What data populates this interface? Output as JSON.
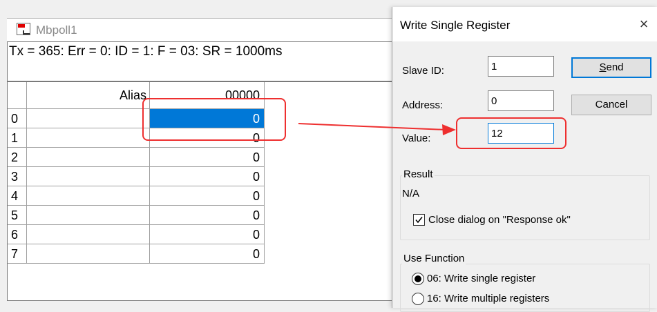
{
  "main_window": {
    "title": "Mbpoll1",
    "status_line": "Tx = 365: Err = 0: ID = 1: F = 03: SR = 1000ms",
    "grid": {
      "headers": {
        "row_number": "",
        "alias": "Alias",
        "register": "00000"
      },
      "rows": [
        {
          "index": "0",
          "alias": "",
          "value": "0",
          "selected": true
        },
        {
          "index": "1",
          "alias": "",
          "value": "0"
        },
        {
          "index": "2",
          "alias": "",
          "value": "0"
        },
        {
          "index": "3",
          "alias": "",
          "value": "0"
        },
        {
          "index": "4",
          "alias": "",
          "value": "0"
        },
        {
          "index": "5",
          "alias": "",
          "value": "0"
        },
        {
          "index": "6",
          "alias": "",
          "value": "0"
        },
        {
          "index": "7",
          "alias": "",
          "value": "0"
        }
      ]
    }
  },
  "dialog": {
    "title": "Write Single Register",
    "close_glyph": "×",
    "slave_id": {
      "label": "Slave ID:",
      "value": "1"
    },
    "address": {
      "label": "Address:",
      "value": "0"
    },
    "value": {
      "label": "Value:",
      "value": "12"
    },
    "send_button": {
      "label_accel": "S",
      "label_rest": "end"
    },
    "cancel_button": {
      "label": "Cancel"
    },
    "result": {
      "title": "Result",
      "text": "N/A",
      "close_on_ok_label": "Close dialog on \"Response ok\"",
      "close_on_ok_checked": true
    },
    "use_function": {
      "title": "Use Function",
      "options": [
        {
          "label": "06: Write single register",
          "selected": true
        },
        {
          "label": "16: Write multiple registers",
          "selected": false
        }
      ]
    }
  },
  "annotation": {
    "color": "#ee2f2f"
  },
  "colors": {
    "selection": "#0078d7",
    "app_icon_tag": "#e00000"
  },
  "icons": {
    "app": "mbpoll-app-icon",
    "close": "close-icon",
    "check": "check-icon"
  }
}
